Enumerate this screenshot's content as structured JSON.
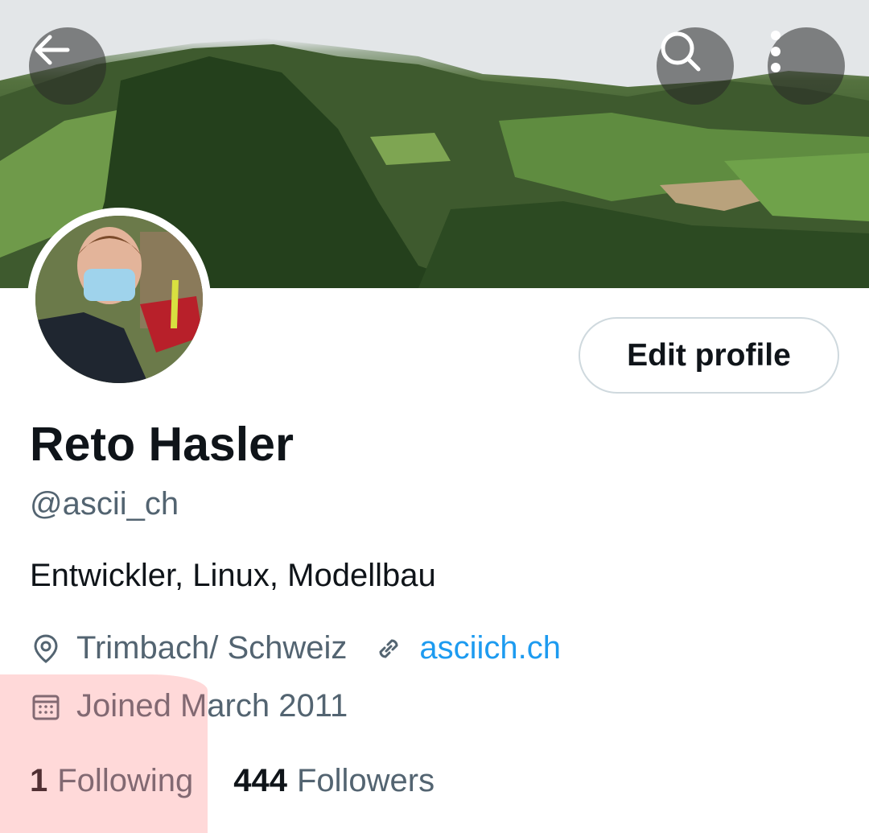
{
  "header": {
    "back_icon": "arrow-left-icon",
    "search_icon": "search-icon",
    "more_icon": "more-vertical-icon"
  },
  "profile": {
    "name": "Reto Hasler",
    "handle": "@ascii_ch",
    "bio": "Entwickler, Linux, Modellbau",
    "location": "Trimbach/ Schweiz",
    "website": "asciich.ch",
    "joined": "Joined March 2011",
    "edit_label": "Edit profile",
    "following_count": "1",
    "following_label": "Following",
    "followers_count": "444",
    "followers_label": "Followers"
  },
  "icons": {
    "location": "location-pin-icon",
    "link": "link-icon",
    "calendar": "calendar-icon"
  },
  "colors": {
    "accent": "#1d9bf0",
    "secondary_text": "#536471",
    "primary_text": "#0f1419",
    "border": "#cfd9de"
  }
}
